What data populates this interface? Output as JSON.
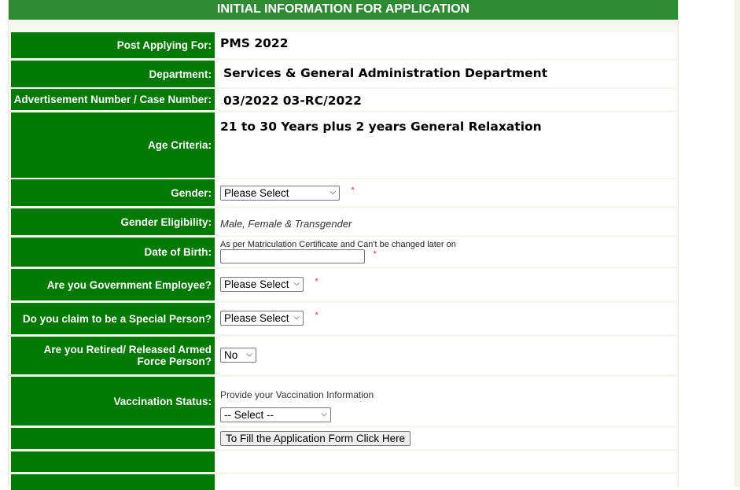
{
  "header": {
    "title": "INITIAL INFORMATION FOR APPLICATION"
  },
  "fields": {
    "post": {
      "label": "Post Applying For:",
      "value": "PMS 2022"
    },
    "department": {
      "label": "Department:",
      "value": "Services & General Administration Department"
    },
    "advertisement": {
      "label": "Advertisement Number / Case Number:",
      "value": "03/2022 03-RC/2022"
    },
    "age": {
      "label": "Age Criteria:",
      "value": "21 to 30 Years plus 2 years General Relaxation"
    },
    "gender": {
      "label": "Gender:",
      "selected": "Please Select",
      "required": "*"
    },
    "gender_eligibility": {
      "label": "Gender Eligibility:",
      "value": "Male, Female & Transgender"
    },
    "dob": {
      "label": "Date of Birth:",
      "hint": "As per Matriculation Certificate and Can't be changed later on",
      "value": "",
      "required": "*"
    },
    "govt_employee": {
      "label": "Are you Government Employee?",
      "selected": "Please Select",
      "required": "*"
    },
    "special_person": {
      "label": "Do you claim to be a Special Person?",
      "selected": "Please Select",
      "required": "*"
    },
    "armed_force": {
      "label": "Are you Retired/ Released Armed Force Person?",
      "selected": "No"
    },
    "vaccination": {
      "label": "Vaccination Status:",
      "hint": "Provide your Vaccination Information",
      "selected": "-- Select --"
    }
  },
  "actions": {
    "fill_form_label": "To Fill the Application Form Click Here"
  }
}
